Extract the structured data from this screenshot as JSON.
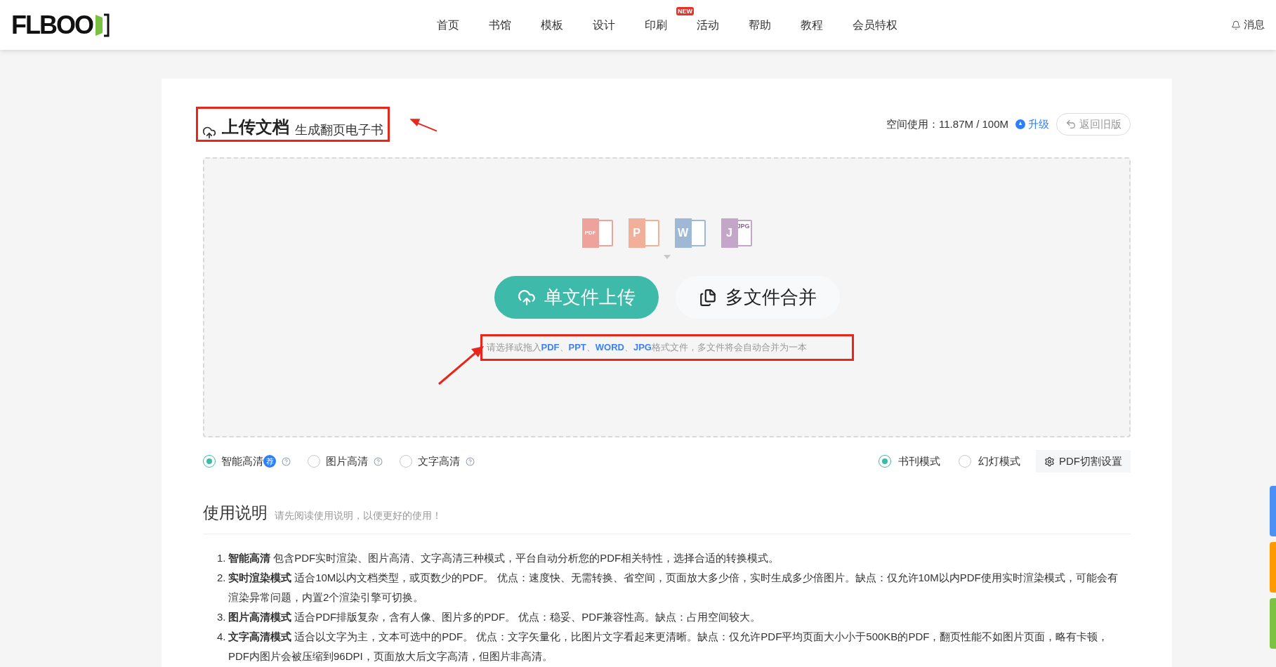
{
  "header": {
    "logo": "FLBOO",
    "nav": [
      {
        "label": "首页"
      },
      {
        "label": "书馆"
      },
      {
        "label": "模板"
      },
      {
        "label": "设计"
      },
      {
        "label": "印刷",
        "badge": "NEW"
      },
      {
        "label": "活动"
      },
      {
        "label": "帮助"
      },
      {
        "label": "教程"
      },
      {
        "label": "会员特权"
      }
    ],
    "messages": "消息"
  },
  "upload": {
    "title": "上传文档",
    "subtitle": "生成翻页电子书",
    "storage": "空间使用：11.87M / 100M",
    "upgrade": "升级",
    "back": "返回旧版",
    "file_icons": [
      {
        "letter": "PDF",
        "kind": "pdf"
      },
      {
        "letter": "P",
        "kind": "ppt"
      },
      {
        "letter": "W",
        "kind": "word"
      },
      {
        "letter": "J",
        "sublabel": "JPG",
        "kind": "jpg"
      }
    ],
    "buttons": [
      {
        "label": "单文件上传",
        "kind": "primary"
      },
      {
        "label": "多文件合并",
        "kind": "secondary"
      }
    ],
    "hint": "请选择或拖入**PDF**、**PPT**、**WORD**、**JPG**格式文件，多文件将会自动合并为一本"
  },
  "quality_options": [
    {
      "label": "智能高清",
      "badge": "荐",
      "selected": true
    },
    {
      "label": "图片高清",
      "selected": false
    },
    {
      "label": "文字高清",
      "selected": false
    }
  ],
  "mode_options": [
    {
      "label": "书刊模式",
      "selected": true
    },
    {
      "label": "幻灯模式",
      "selected": false
    }
  ],
  "pdf_split_button": "PDF切割设置",
  "usage": {
    "title": "使用说明",
    "subtitle": "请先阅读使用说明，以便更好的使用！",
    "items": [
      {
        "number": "1.",
        "term": "智能高清",
        "text": "包含PDF实时渲染、图片高清、文字高清三种模式，平台自动分析您的PDF相关特性，选择合适的转换模式。"
      },
      {
        "number": "2.",
        "term": "实时渲染模式",
        "text": "适合10M以内文档类型，或页数少的PDF。 优点：速度快、无需转换、省空间，页面放大多少倍，实时生成多少倍图片。缺点：仅允许10M以内PDF使用实时渲染模式，可能会有渲染异常问题，内置2个渲染引擎可切换。"
      },
      {
        "number": "3.",
        "term": "图片高清模式",
        "text": "适合PDF排版复杂，含有人像、图片多的PDF。 优点：稳妥、PDF兼容性高。缺点：占用空间较大。"
      },
      {
        "number": "4.",
        "term": "文字高清模式",
        "text": "适合以文字为主，文本可选中的PDF。 优点：文字矢量化，比图片文字看起来更清晰。缺点：仅允许PDF平均页面大小小于500KB的PDF，翻页性能不如图片页面，略有卡顿，PDF内图片会被压缩到96DPI，页面放大后文字高清，但图片非高清。"
      }
    ]
  },
  "side_tabs": [
    {
      "color": "#4a90f5"
    },
    {
      "color": "#ff9900"
    },
    {
      "color": "#7cc243"
    }
  ]
}
